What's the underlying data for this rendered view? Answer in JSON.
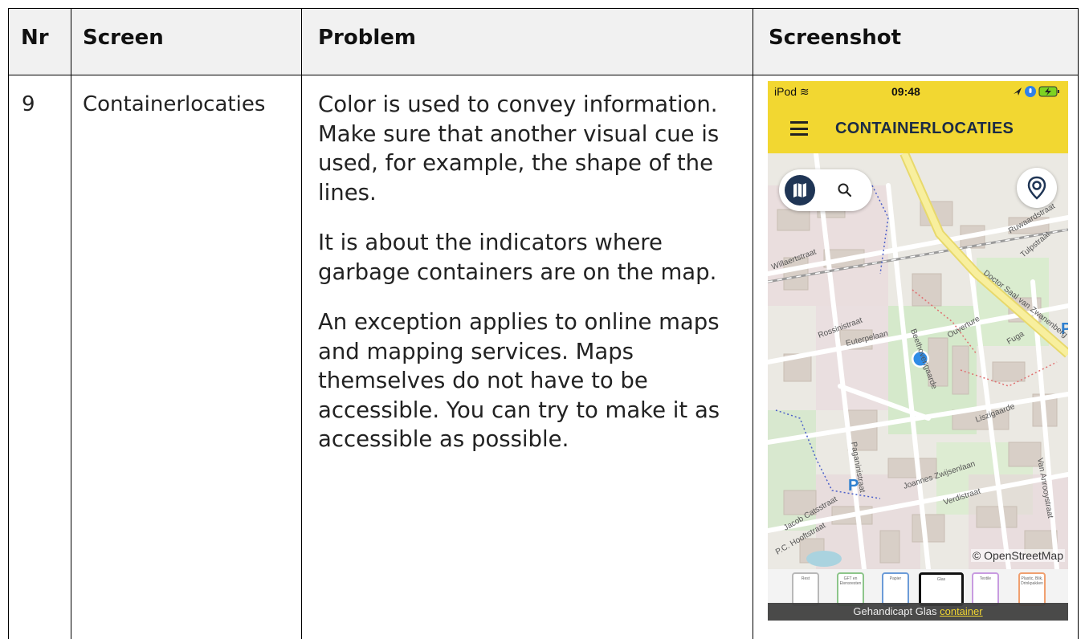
{
  "table": {
    "headers": {
      "nr": "Nr",
      "screen": "Screen",
      "problem": "Problem",
      "screenshot": "Screenshot"
    },
    "row": {
      "nr": "9",
      "screen": "Containerlocaties",
      "problem_paragraphs": [
        "Color is used to convey information. Make sure that another visual cue is used, for example, the shape of the lines.",
        "It is about the indicators where garbage containers are on the map.",
        "An exception applies to online maps and mapping services. Maps themselves do not have to be accessible. You can try to make it as accessible as possible."
      ]
    }
  },
  "phone": {
    "status": {
      "carrier": "iPod",
      "time": "09:48"
    },
    "app_title": "CONTAINERLOCATIES",
    "map": {
      "attribution": "© OpenStreetMap",
      "street_labels": [
        "Euterpelaan",
        "Rossinistraat",
        "Beethovengaarde",
        "Liszigaarde",
        "Joannes Zwijsenlaan",
        "Verdistraat",
        "Doctor Saal van Zwanenberg",
        "Willaertstraat",
        "Ouverture",
        "Fuga",
        "Jacob Catsstraat",
        "P.C. Hooftstraat",
        "Paganinistraat",
        "Tulpstraat",
        "Ruwaardstraat",
        "Van Anrooystraat"
      ]
    },
    "categories": [
      {
        "label": "Rest",
        "color": "#b8b8b8"
      },
      {
        "label": "GFT en Etensresten",
        "color": "#8dc58a"
      },
      {
        "label": "Papier",
        "color": "#6b9bd8"
      },
      {
        "label": "Glas",
        "color": "#111111"
      },
      {
        "label": "Textile",
        "color": "#c89be0"
      },
      {
        "label": "Plastic, Blik, Drinkpakken",
        "color": "#f0a070"
      }
    ],
    "caption": {
      "text": "Gehandicapt Glas",
      "link": "container"
    },
    "colors": {
      "accent_yellow": "#f2d731",
      "navy": "#1f3555",
      "location_dot": "#2f8ce6"
    }
  }
}
